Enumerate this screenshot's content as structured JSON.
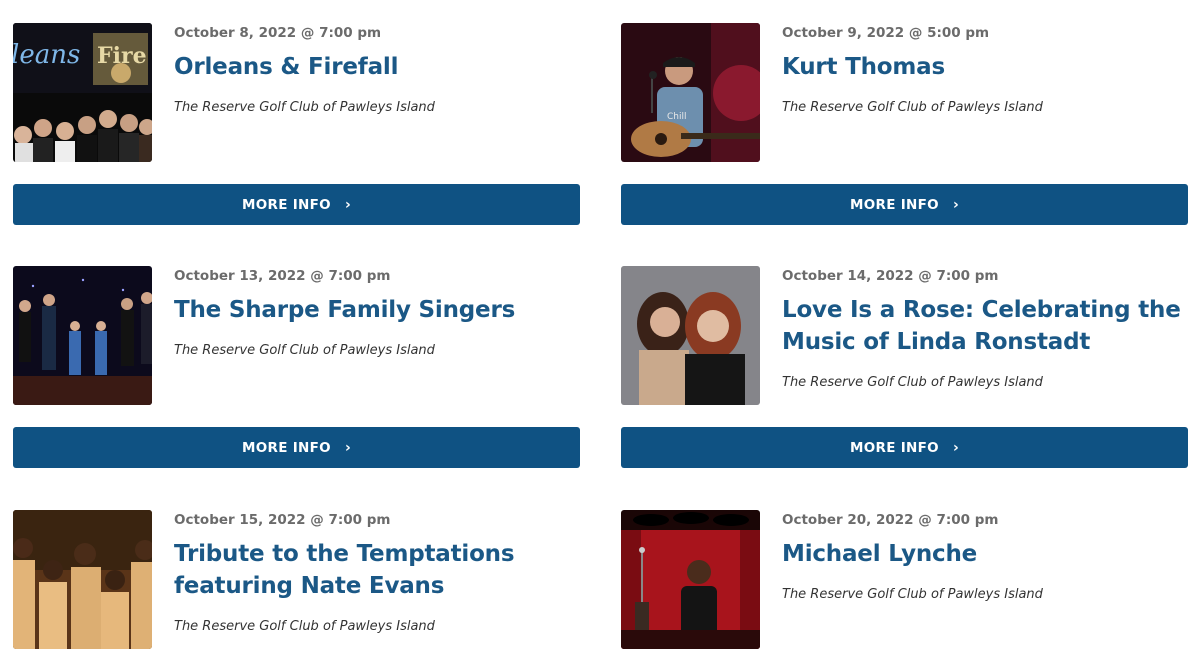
{
  "events": [
    {
      "date": "October 8, 2022 @ 7:00 pm",
      "title": "Orleans & Firefall",
      "venue": "The Reserve Golf Club of Pawleys Island",
      "button": "MORE INFO",
      "image": "band-photo-orleans-firefall"
    },
    {
      "date": "October 9, 2022 @ 5:00 pm",
      "title": "Kurt Thomas",
      "venue": "The Reserve Golf Club of Pawleys Island",
      "button": "MORE INFO",
      "image": "singer-with-guitar-photo"
    },
    {
      "date": "October 13, 2022 @ 7:00 pm",
      "title": "The Sharpe Family Singers",
      "venue": "The Reserve Golf Club of Pawleys Island",
      "button": "MORE INFO",
      "image": "family-singers-stage-photo"
    },
    {
      "date": "October 14, 2022 @ 7:00 pm",
      "title": "Love Is a Rose: Celebrating the Music of Linda Ronstadt",
      "venue": "The Reserve Golf Club of Pawleys Island",
      "button": "MORE INFO",
      "image": "two-women-portrait-photo"
    },
    {
      "date": "October 15, 2022 @ 7:00 pm",
      "title": "Tribute to the Temptations featuring Nate Evans",
      "venue": "The Reserve Golf Club of Pawleys Island",
      "button": "MORE INFO",
      "image": "group-in-tan-suits-photo"
    },
    {
      "date": "October 20, 2022 @ 7:00 pm",
      "title": "Michael Lynche",
      "venue": "The Reserve Golf Club of Pawleys Island",
      "button": "MORE INFO",
      "image": "singer-red-curtain-photo"
    }
  ],
  "colors": {
    "title": "#1b5886",
    "button": "#0f5283",
    "date": "#6b6b6b"
  }
}
